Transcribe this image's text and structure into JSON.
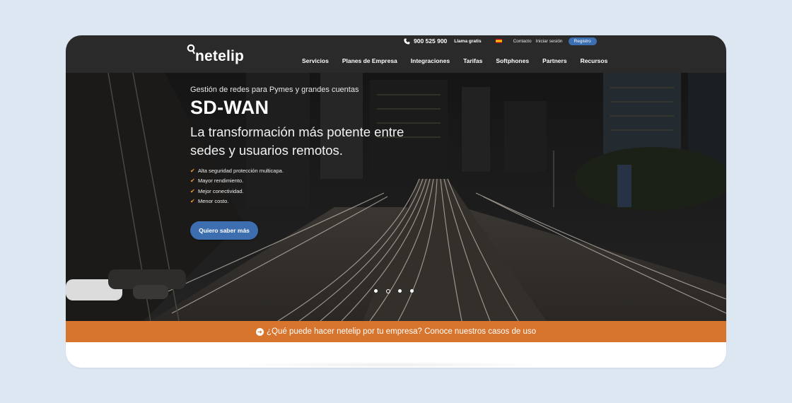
{
  "header": {
    "logo_text": "netelip",
    "phone_number": "900 525 900",
    "free_call": "Llama gratis",
    "contact": "Contacto",
    "login": "Iniciar sesión",
    "register": "Registro",
    "nav": [
      "Servicios",
      "Planes de Empresa",
      "Integraciones",
      "Tarifas",
      "Softphones",
      "Partners",
      "Recursos"
    ]
  },
  "hero": {
    "kicker": "Gestión de redes para Pymes y grandes cuentas",
    "title": "SD-WAN",
    "subtitle": "La transformación más potente entre sedes y usuarios remotos.",
    "features": [
      "Alta seguridad protección multicapa.",
      "Mayor rendimiento.",
      "Mejor conectividad.",
      "Menor costo."
    ],
    "cta": "Quiero saber más",
    "carousel_dots": 4,
    "carousel_active": 2
  },
  "banner": {
    "text": "¿Qué puede hacer netelip por tu empresa? Conoce nuestros casos de uso"
  },
  "colors": {
    "header_bg": "#2a2a2a",
    "accent_blue": "#3d6fb0",
    "banner_orange": "#d7742d",
    "check_orange": "#f0a030",
    "page_bg": "#dce7f1"
  },
  "icons": [
    "logo-pin-icon",
    "phone-icon",
    "spain-flag-icon",
    "check-icon",
    "arrow-circle-icon"
  ]
}
